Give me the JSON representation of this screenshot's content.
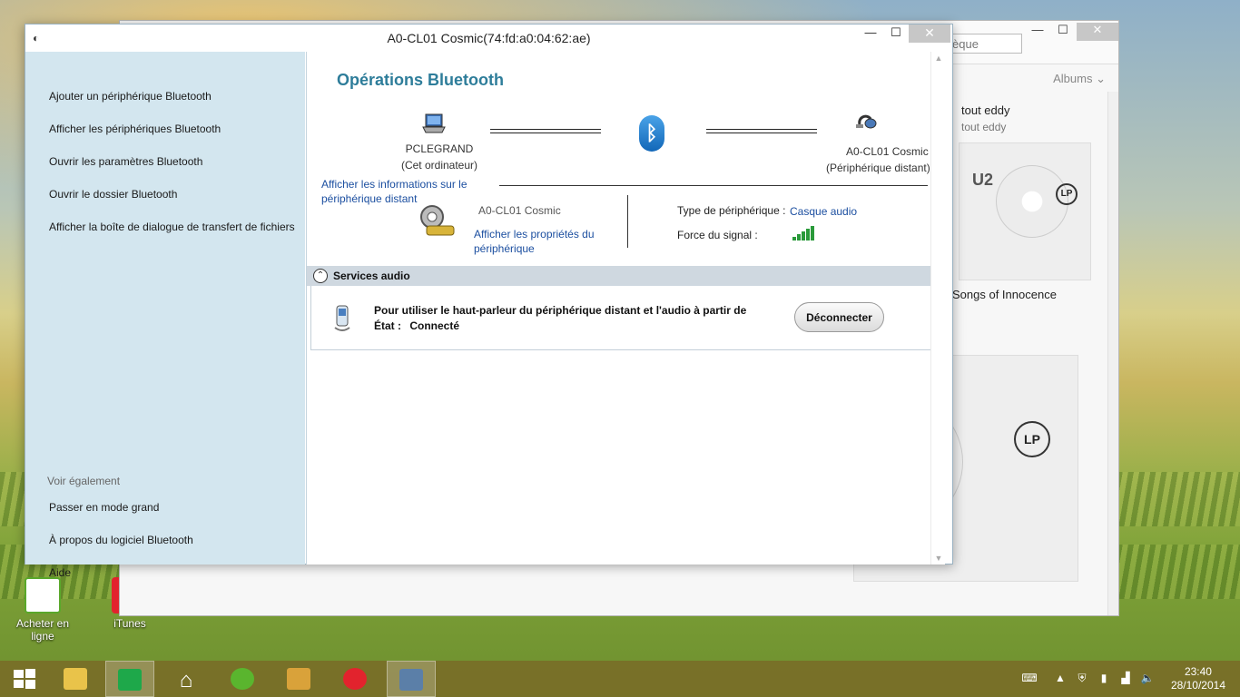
{
  "window": {
    "title": "A0-CL01 Cosmic(74:fd:a0:04:62:ae)",
    "minimize": "—",
    "maximize": "☐",
    "close": "✕"
  },
  "sidebar": {
    "items": [
      {
        "label": "Ajouter un périphérique Bluetooth"
      },
      {
        "label": "Afficher les périphériques Bluetooth"
      },
      {
        "label": "Ouvrir les paramètres Bluetooth"
      },
      {
        "label": "Ouvrir le dossier Bluetooth"
      },
      {
        "label": "Afficher la boîte de dialogue de transfert de fichiers"
      }
    ],
    "see_also_heading": "Voir également",
    "see_also": [
      {
        "label": "Passer en mode grand"
      },
      {
        "label": "À propos du logiciel Bluetooth"
      },
      {
        "label": "Aide"
      }
    ]
  },
  "main": {
    "title": "Opérations Bluetooth",
    "local_device": {
      "name": "PCLEGRAND",
      "subtitle": "(Cet ordinateur)",
      "icon": "laptop-icon"
    },
    "remote_device": {
      "name": "A0-CL01 Cosmic",
      "subtitle": "(Périphérique distant)",
      "icon": "headset-icon"
    },
    "info_link": "Afficher les informations sur le périphérique distant",
    "device_name": "A0-CL01 Cosmic",
    "properties_link": "Afficher les propriétés du périphérique",
    "type_label": "Type de périphérique :",
    "type_value": "Casque audio",
    "signal_label": "Force du signal :",
    "signal_bars_filled": 5,
    "signal_bars_total": 5
  },
  "services": {
    "heading": "Services audio",
    "description": "Pour utiliser le haut-parleur du périphérique distant et l'audio à partir de",
    "state_label": "État :",
    "state_value": "Connecté",
    "disconnect_button": "Déconnecter"
  },
  "background_window": {
    "search_placeholder": "èque",
    "albums_dropdown": "Albums",
    "album1_title": "tout eddy",
    "album1_artist": "tout eddy",
    "album2_art_text": "U2",
    "album2_title": "Songs of Innocence"
  },
  "desktop_icons": [
    {
      "label": "Acheter en ligne"
    },
    {
      "label": "iTunes"
    }
  ],
  "taskbar": {
    "time": "23:40",
    "date": "28/10/2014"
  }
}
